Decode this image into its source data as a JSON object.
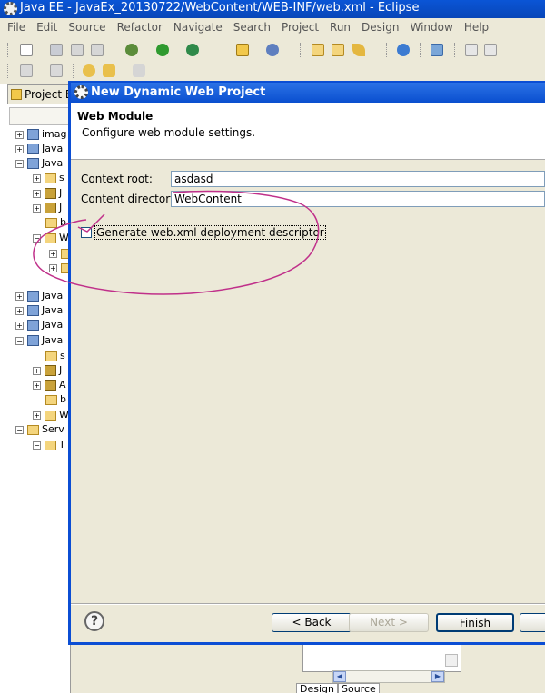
{
  "window": {
    "title": "Java EE - JavaEx_20130722/WebContent/WEB-INF/web.xml - Eclipse"
  },
  "menu": [
    "File",
    "Edit",
    "Source",
    "Refactor",
    "Navigate",
    "Search",
    "Project",
    "Run",
    "Design",
    "Window",
    "Help"
  ],
  "project_explorer": {
    "tab_label": "Project E",
    "tree": [
      {
        "text": "imag"
      },
      {
        "text": "Java"
      },
      {
        "text": "Java"
      },
      {
        "text": "s"
      },
      {
        "text": "J"
      },
      {
        "text": "J"
      },
      {
        "text": "b"
      },
      {
        "text": "W"
      },
      {
        "text": ""
      },
      {
        "text": ""
      },
      {
        "text": "Java"
      },
      {
        "text": "Java"
      },
      {
        "text": "Java"
      },
      {
        "text": "Java"
      },
      {
        "text": "s"
      },
      {
        "text": "J"
      },
      {
        "text": "A"
      },
      {
        "text": "b"
      },
      {
        "text": "W"
      },
      {
        "text": "Serv"
      },
      {
        "text": "T"
      }
    ]
  },
  "dialog": {
    "title": "New Dynamic Web Project",
    "header_title": "Web Module",
    "header_desc": "Configure web module settings.",
    "context_root_label": "Context root:",
    "context_root_value": "asdasd",
    "content_dir_label": "Content directory:",
    "content_dir_value": "WebContent",
    "generate_label": "Generate web.xml deployment descriptor",
    "generate_checked": false,
    "help_symbol": "?",
    "buttons": {
      "back": "< Back",
      "next": "Next >",
      "finish": "Finish"
    }
  },
  "editor": {
    "tabs": [
      "Design",
      "Source"
    ]
  },
  "annotation_color": "#c0308a"
}
